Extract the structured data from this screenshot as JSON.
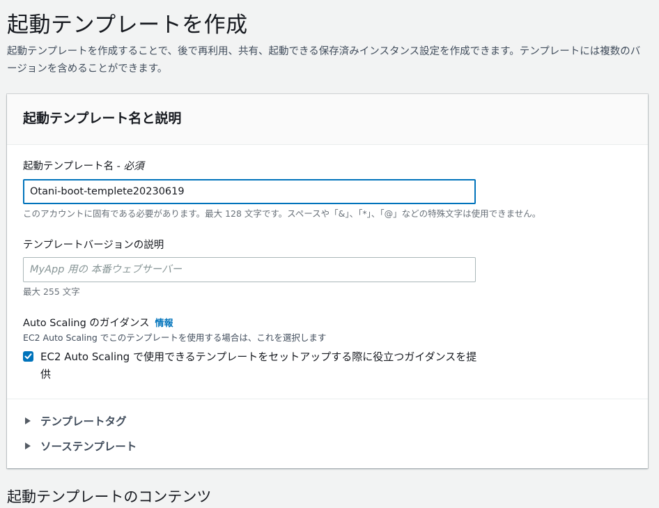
{
  "page": {
    "title": "起動テンプレートを作成",
    "description": "起動テンプレートを作成することで、後で再利用、共有、起動できる保存済みインスタンス設定を作成できます。テンプレートには複数のバージョンを含めることができます。"
  },
  "panel": {
    "title": "起動テンプレート名と説明",
    "name_field": {
      "label": "起動テンプレート名 - ",
      "required": "必須",
      "value": "Otani-boot-templete20230619",
      "hint": "このアカウントに固有である必要があります。最大 128 文字です。スペースや「&」、「*」、「@」などの特殊文字は使用できません。"
    },
    "version_field": {
      "label": "テンプレートバージョンの説明",
      "value": "",
      "placeholder": "MyApp 用の 本番ウェブサーバー",
      "hint": "最大 255 文字"
    },
    "auto_scaling": {
      "label": "Auto Scaling のガイダンス",
      "info_link": "情報",
      "description": "EC2 Auto Scaling でこのテンプレートを使用する場合は、これを選択します",
      "checkbox_label": "EC2 Auto Scaling で使用できるテンプレートをセットアップする際に役立つガイダンスを提供",
      "checked": true
    },
    "expanders": [
      {
        "label": "テンプレートタグ"
      },
      {
        "label": "ソーステンプレート"
      }
    ]
  },
  "next_section": {
    "title": "起動テンプレートのコンテンツ"
  },
  "colors": {
    "accent": "#0073bb",
    "background": "#f2f3f3",
    "text": "#16191f",
    "secondary_text": "#687078"
  }
}
